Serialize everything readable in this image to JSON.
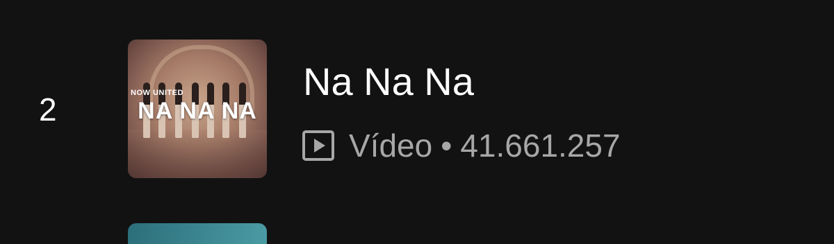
{
  "track": {
    "rank": "2",
    "title": "Na Na Na",
    "type_label": "Vídeo",
    "separator": "•",
    "views": "41.661.257",
    "type_icon": "video-play-icon",
    "cover": {
      "brand_text": "NOW UNITED",
      "art_title": "NA NA NA"
    }
  },
  "colors": {
    "background": "#121212",
    "primary_text": "#ffffff",
    "secondary_text": "#a7a7a7"
  }
}
